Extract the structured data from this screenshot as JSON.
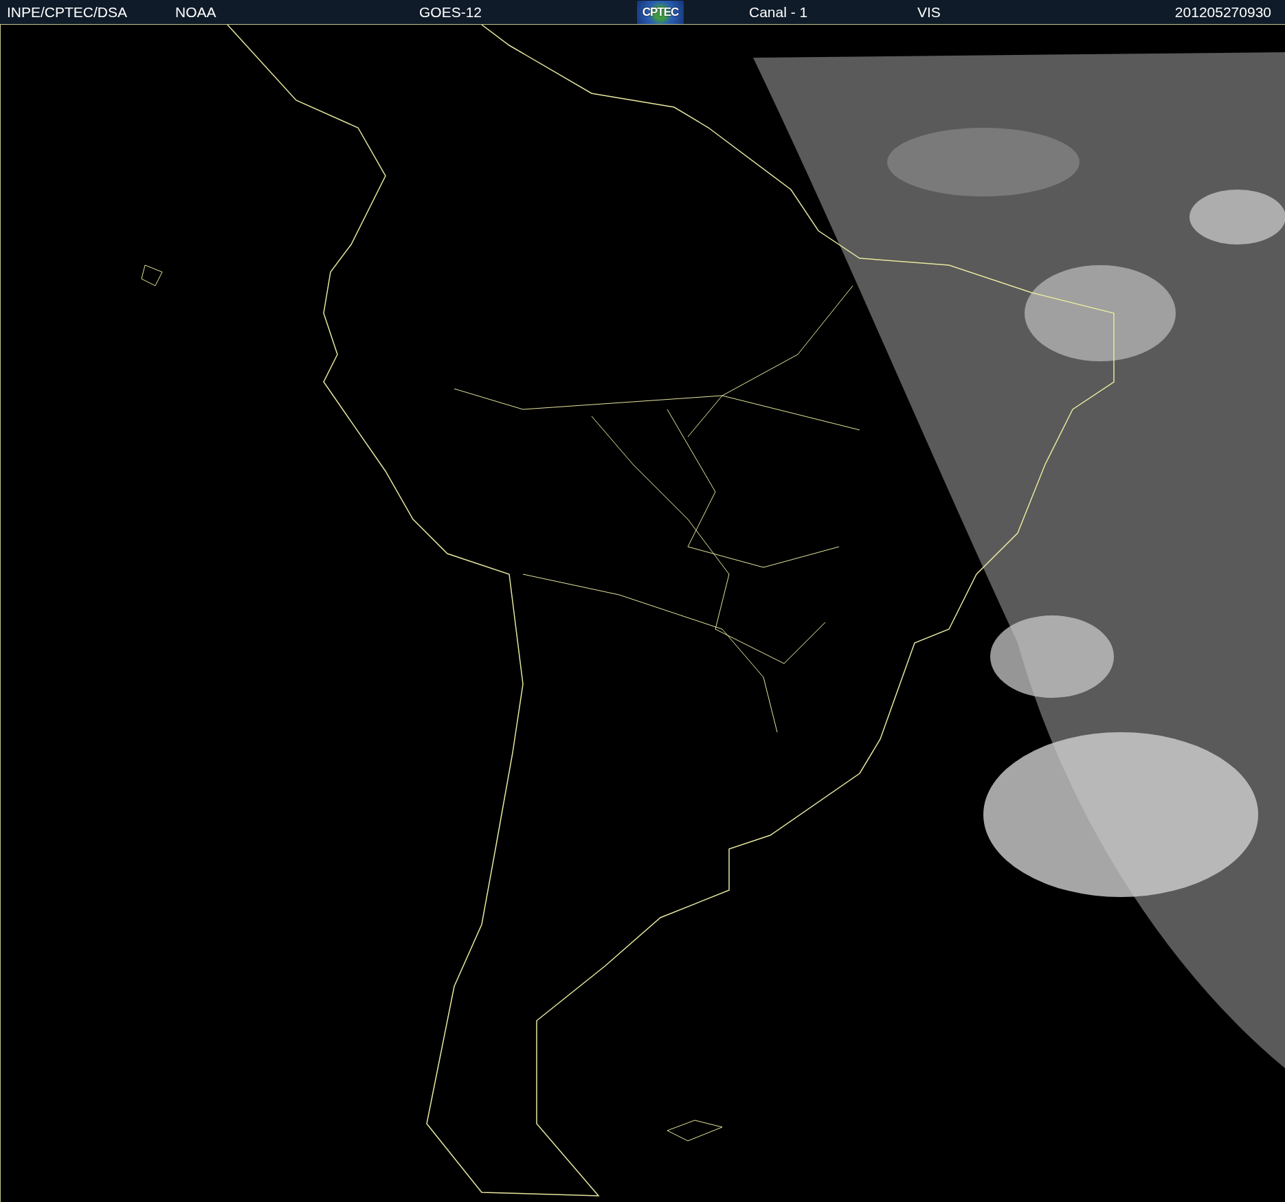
{
  "header": {
    "source": "INPE/CPTEC/DSA",
    "agency": "NOAA",
    "satellite": "GOES-12",
    "logo": "CPTEC",
    "channel": "Canal - 1",
    "band": "VIS",
    "timestamp": "201205270930"
  }
}
